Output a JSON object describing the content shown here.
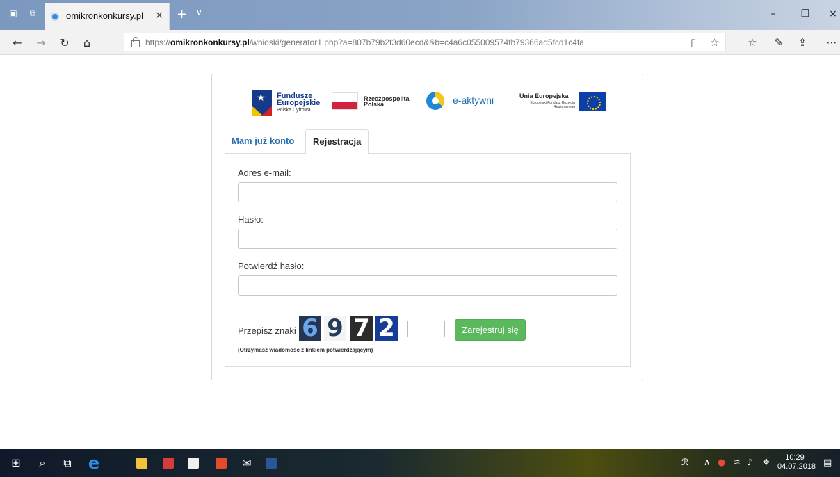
{
  "browser": {
    "tab_title": "omikronkonkursy.pl",
    "tab_close": "×",
    "new_tab": "+",
    "tab_menu": "∨",
    "url_prefix": "https://",
    "url_domain": "omikronkonkursy.pl",
    "url_path": "/wnioski/generator1.php?a=807b79b2f3d60ecd&&b=c4a6c055009574fb79366ad5fcd1c4fa",
    "window_controls": [
      "–",
      "❐",
      "×"
    ]
  },
  "logos": {
    "fe_line1": "Fundusze",
    "fe_line2": "Europejskie",
    "fe_line3": "Polska Cyfrowa",
    "rp_line1": "Rzeczpospolita",
    "rp_line2": "Polska",
    "ea_text": "e-aktywni",
    "ue_line1": "Unia Europejska",
    "ue_line2": "Europejski Fundusz Rozwoju Regionalnego"
  },
  "form": {
    "tab_login": "Mam już konto",
    "tab_register": "Rejestracja",
    "email_label": "Adres e-mail:",
    "email_value": "",
    "password_label": "Hasło:",
    "password_value": "",
    "confirm_label": "Potwierdź hasło:",
    "confirm_value": "",
    "captcha_label": "Przepisz znaki",
    "captcha_digits": [
      "6",
      "9",
      "7",
      "2"
    ],
    "captcha_value": "",
    "register_button": "Zarejestruj się",
    "note": "(Otrzymasz wiadomość z linkiem potwierdzającym)"
  },
  "taskbar": {
    "time": "10:29",
    "date": "04.07.2018"
  },
  "colors": {
    "link_blue": "#2a6db0",
    "button_green": "#5cb85c",
    "titlebar_blue": "#7b98bf"
  },
  "icons": [
    "tab-preview-icon",
    "set-aside-icon",
    "favicon",
    "back-icon",
    "forward-icon",
    "refresh-icon",
    "home-icon",
    "lock-icon",
    "reading-view-icon",
    "favorite-star-icon",
    "favorites-hub-icon",
    "notes-pen-icon",
    "share-icon",
    "more-icon",
    "windows-start-icon",
    "search-icon",
    "task-view-icon",
    "edge-icon",
    "file-explorer-icon",
    "mail-icon",
    "store-icon",
    "app-icon",
    "envelope-icon",
    "word-icon",
    "people-icon",
    "chevron-up-icon",
    "network-icon",
    "volume-icon",
    "dropbox-icon",
    "notification-icon"
  ]
}
